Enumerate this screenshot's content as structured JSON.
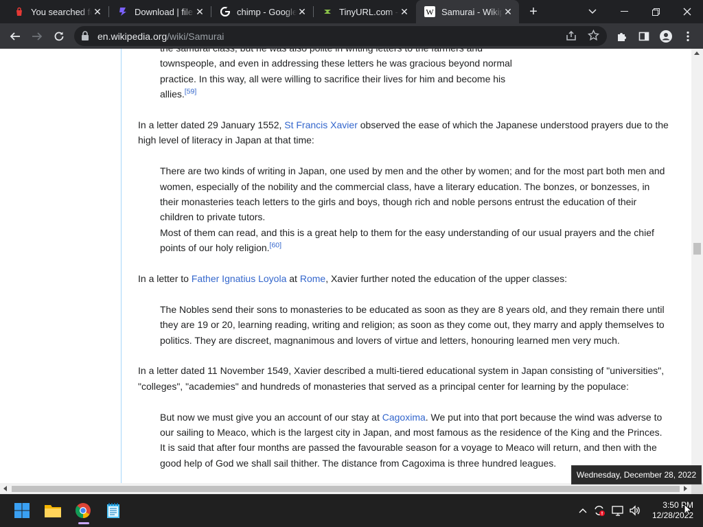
{
  "browser": {
    "tabs": [
      {
        "title": "You searched for",
        "icon": "red-bag-icon",
        "active": false
      },
      {
        "title": "Download | file.",
        "icon": "purple-file-icon",
        "active": false
      },
      {
        "title": "chimp - Google",
        "icon": "google-icon",
        "active": false
      },
      {
        "title": "TinyURL.com - s",
        "icon": "tinyurl-icon",
        "active": false
      },
      {
        "title": "Samurai - Wikip",
        "icon": "wikipedia-icon",
        "active": true
      }
    ],
    "new_tab_label": "+",
    "url_domain": "en.wikipedia.org",
    "url_path": "/wiki/Samurai"
  },
  "article": {
    "quote1": {
      "line1": "the samurai class, but he was also polite in writing letters to the farmers and",
      "line2": "townspeople, and even in addressing these letters he was gracious beyond normal",
      "line3": "practice. In this way, all were willing to sacrifice their lives for him and become his",
      "line4": "allies.",
      "ref": "[59]"
    },
    "para1": {
      "before": "In a letter dated 29 January 1552, ",
      "link": "St Francis Xavier",
      "after": " observed the ease of which the Japanese understood prayers due to the high level of literacy in Japan at that time:"
    },
    "quote2": {
      "text1": "There are two kinds of writing in Japan, one used by men and the other by women; and for the most part both men and women, especially of the nobility and the commercial class, have a literary education. The bonzes, or bonzesses, in their monasteries teach letters to the girls and boys, though rich and noble persons entrust the education of their children to private tutors.",
      "text2": "Most of them can read, and this is a great help to them for the easy understanding of our usual prayers and the chief points of our holy religion.",
      "ref": "[60]"
    },
    "para2": {
      "before": "In a letter to ",
      "link1": "Father Ignatius Loyola",
      "mid": " at ",
      "link2": "Rome",
      "after": ", Xavier further noted the education of the upper classes:"
    },
    "quote3": {
      "text": "The Nobles send their sons to monasteries to be educated as soon as they are 8 years old, and they remain there until they are 19 or 20, learning reading, writing and religion; as soon as they come out, they marry and apply themselves to politics. They are discreet, magnanimous and lovers of virtue and letters, honouring learned men very much."
    },
    "para3": {
      "text": "In a letter dated 11 November 1549, Xavier described a multi-tiered educational system in Japan consisting of \"universities\", \"colleges\", \"academies\" and hundreds of monasteries that served as a principal center for learning by the populace:"
    },
    "quote4": {
      "before": "But now we must give you an account of our stay at ",
      "link": "Cagoxima",
      "after": ". We put into that port because the wind was adverse to our sailing to Meaco, which is the largest city in Japan, and most famous as the residence of the King and the Princes. It is said that after four months are passed the favourable season for a voyage to Meaco will return, and then with the good help of God we shall sail thither. The distance from Cagoxima is three hundred leagues."
    }
  },
  "taskbar": {
    "time": "3:50 PM",
    "date": "12/28/2022",
    "tooltip": "Wednesday, December 28, 2022"
  },
  "colors": {
    "link": "#3366cc",
    "text": "#202122",
    "tab_strip": "#202124",
    "toolbar": "#35363a"
  }
}
